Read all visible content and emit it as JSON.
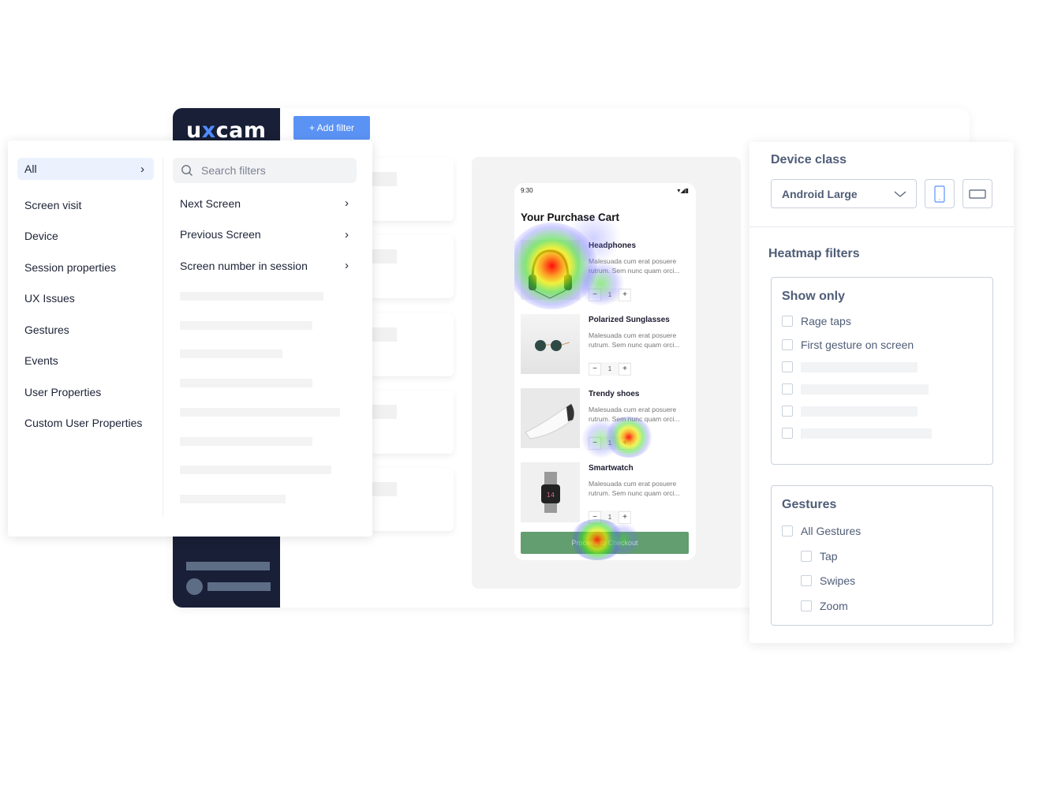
{
  "app": {
    "logo": {
      "prefix": "u",
      "accent": "x",
      "suffix": "cam"
    },
    "add_filter_label": "+ Add filter",
    "colors": {
      "sidebar": "#181f36",
      "accent": "#5b93f5",
      "checkout": "#629e6f",
      "panel_text": "#4f5d77"
    }
  },
  "filter_popup": {
    "categories": [
      {
        "label": "All",
        "active": true
      },
      {
        "label": "Screen visit"
      },
      {
        "label": "Device"
      },
      {
        "label": "Session properties"
      },
      {
        "label": "UX Issues"
      },
      {
        "label": "Gestures"
      },
      {
        "label": "Events"
      },
      {
        "label": "User Properties"
      },
      {
        "label": "Custom User Properties"
      }
    ],
    "search": {
      "placeholder": "Search filters",
      "value": ""
    },
    "sub_items": [
      {
        "label": "Next Screen"
      },
      {
        "label": "Previous Screen"
      },
      {
        "label": "Screen number in session"
      }
    ],
    "chevron": "›"
  },
  "phone": {
    "time": "9:30",
    "status_icons": "▾◢▮",
    "title": "Your Purchase Cart",
    "products": [
      {
        "name": "Headphones",
        "desc": "Malesuada cum erat posuere rutrum. Sem nunc quam orci...",
        "qty": "1"
      },
      {
        "name": "Polarized Sunglasses",
        "desc": "Malesuada cum erat posuere rutrum. Sem nunc quam orci...",
        "qty": "1"
      },
      {
        "name": "Trendy shoes",
        "desc": "Malesuada cum erat posuere rutrum. Sem nunc quam orci...",
        "qty": "1"
      },
      {
        "name": "Smartwatch",
        "desc": "Malesuada cum erat posuere rutrum. Sem nunc quam orci...",
        "qty": "1"
      }
    ],
    "minus": "−",
    "plus": "+",
    "checkout_label": "Proceed to Checkout"
  },
  "right_panel": {
    "device_class_title": "Device class",
    "device_selected": "Android Large",
    "heatmap_filters_title": "Heatmap filters",
    "show_only": {
      "title": "Show only",
      "options": [
        {
          "label": "Rage taps",
          "checked": false
        },
        {
          "label": "First gesture on screen",
          "checked": false
        }
      ]
    },
    "gestures": {
      "title": "Gestures",
      "all_label": "All Gestures",
      "options": [
        {
          "label": "Tap",
          "checked": false
        },
        {
          "label": "Swipes",
          "checked": false
        },
        {
          "label": "Zoom",
          "checked": false
        }
      ]
    }
  }
}
